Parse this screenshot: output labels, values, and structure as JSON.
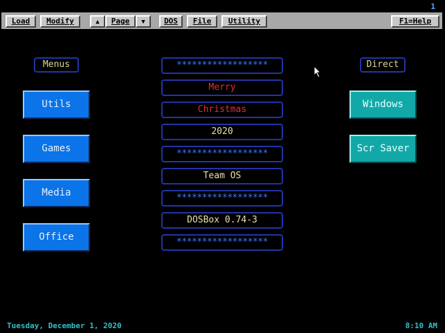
{
  "page_indicator": "1",
  "toolbar": {
    "load": "Load",
    "modify": "Modify",
    "page": "Page",
    "dos": "DOS",
    "file": "File",
    "utility": "Utility",
    "help": "F1=Help",
    "up_arrow": "▲",
    "down_arrow": "▼"
  },
  "menus": {
    "title": "Menus",
    "items": [
      "Utils",
      "Games",
      "Media",
      "Office"
    ]
  },
  "center": {
    "lines": [
      "******************",
      "Merry",
      "Christmas",
      "2020",
      "******************",
      "Team OS",
      "******************",
      "DOSBox 0.74-3",
      "******************"
    ]
  },
  "direct": {
    "title": "Direct",
    "items": [
      "Windows",
      "Scr Saver"
    ]
  },
  "status": {
    "date": "Tuesday, December 1, 2020",
    "time": "8:10 AM"
  },
  "colors": {
    "menu_button": "#0a74e8",
    "direct_button": "#12a8a8",
    "frame_border": "#2234a8",
    "red_text": "#e03030",
    "status_text": "#30c0c8"
  }
}
